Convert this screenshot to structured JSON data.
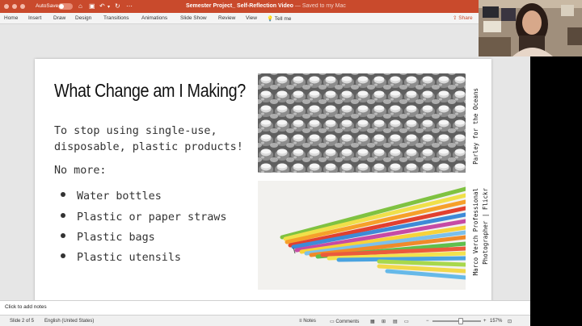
{
  "titlebar": {
    "autosave_label": "AutoSave",
    "autosave_state": "OFF",
    "doc_title": "Semester Project_ Self-Reflection Video",
    "saved_status": "— Saved to my Mac",
    "bg_color": "#c94a2c"
  },
  "ribbon": {
    "tabs": [
      "Home",
      "Insert",
      "Draw",
      "Design",
      "Transitions",
      "Animations",
      "Slide Show",
      "Review",
      "View"
    ],
    "tell_me": "Tell me",
    "share": "Share"
  },
  "slide": {
    "title": "What Change am I Making?",
    "body_line1": "To stop using single-use,",
    "body_line2": "disposable, plastic products!",
    "no_more": "No more:",
    "bullets": [
      "Water bottles",
      "Plastic or paper straws",
      "Plastic bags",
      "Plastic utensils"
    ],
    "credit_1": "Parley for the Oceans",
    "credit_2_line1": "Marco Verch Professional",
    "credit_2_line2": "Photographer | Flickr"
  },
  "notes": {
    "placeholder": "Click to add notes"
  },
  "statusbar": {
    "slide_info": "Slide 2 of 5",
    "language": "English (United States)",
    "notes_label": "Notes",
    "comments_label": "Comments",
    "zoom_minus": "−",
    "zoom_plus": "+",
    "zoom_level": "157%"
  }
}
